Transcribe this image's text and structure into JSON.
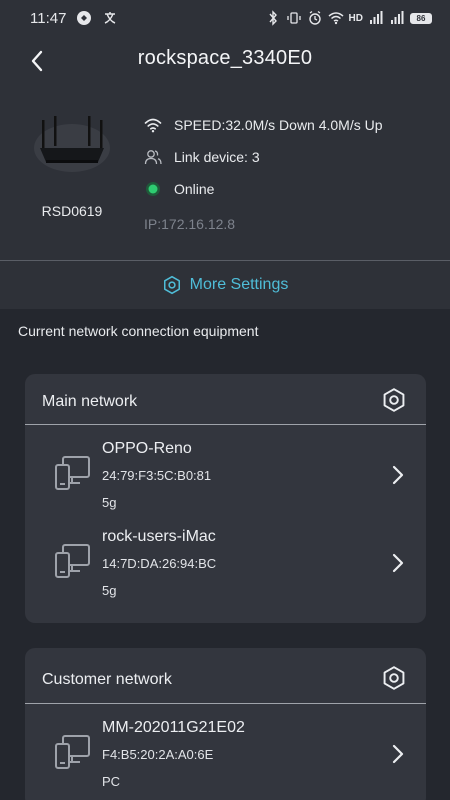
{
  "status_bar": {
    "time": "11:47",
    "battery": "86",
    "network_label": "HD"
  },
  "header": {
    "title": "rockspace_3340E0"
  },
  "device": {
    "model": "RSD0619",
    "speed": "SPEED:32.0M/s Down 4.0M/s Up",
    "link_device": "Link device: 3",
    "status": "Online",
    "ip": "IP:172.16.12.8",
    "status_color": "#2ecc71"
  },
  "more_settings": {
    "label": "More Settings",
    "color": "#4fbdd8"
  },
  "section_label": "Current network connection equipment",
  "networks": [
    {
      "title": "Main network",
      "devices": [
        {
          "name": "OPPO-Reno",
          "mac": "24:79:F3:5C:B0:81",
          "band": "5g"
        },
        {
          "name": "rock-users-iMac",
          "mac": "14:7D:DA:26:94:BC",
          "band": "5g"
        }
      ]
    },
    {
      "title": "Customer network",
      "devices": [
        {
          "name": "MM-202011G21E02",
          "mac": "F4:B5:20:2A:A0:6E",
          "band": "PC"
        }
      ]
    }
  ],
  "icons": {
    "back": "chevron-left-icon",
    "wifi": "wifi-icon",
    "users": "users-icon",
    "status_dot": "status-dot-icon",
    "gear": "gear-icon",
    "device": "device-icon",
    "chevron": "chevron-right-icon"
  }
}
